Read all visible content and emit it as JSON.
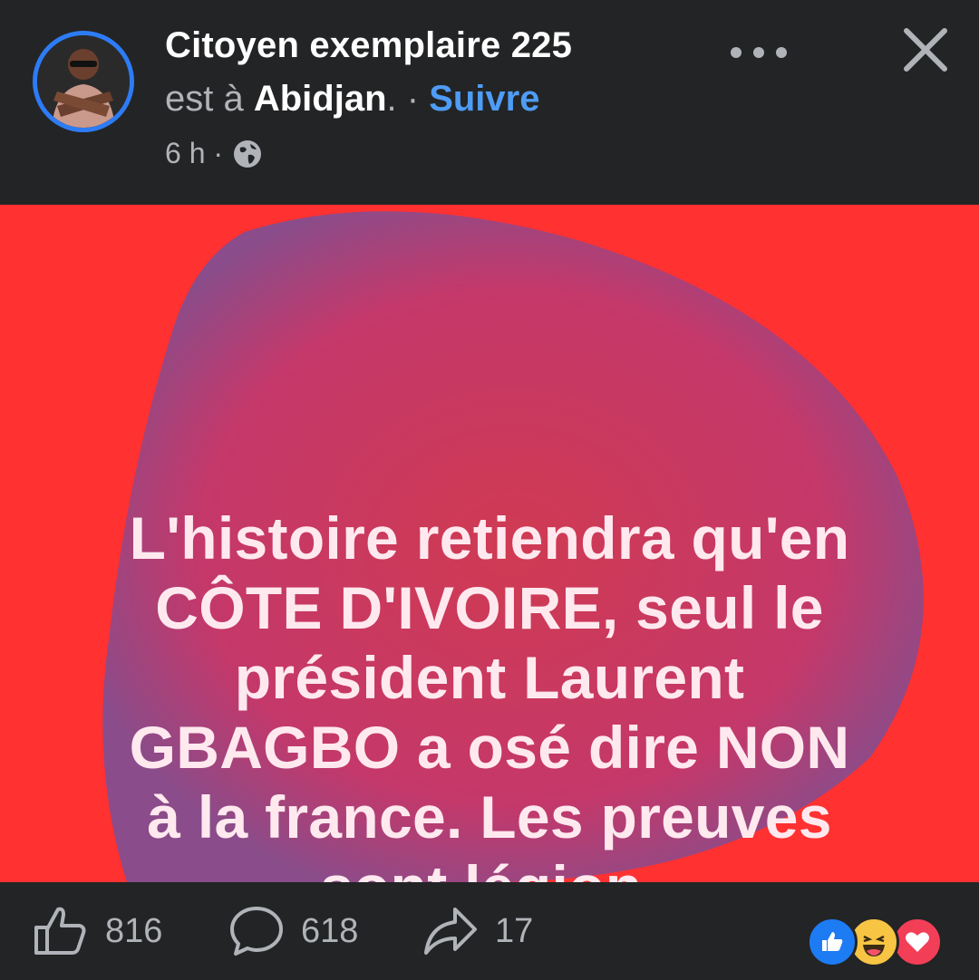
{
  "header": {
    "author_name": "Citoyen exemplaire 225",
    "location_prefix": "est à ",
    "location_place": "Abidjan",
    "location_suffix": ". · ",
    "follow_label": "Suivre",
    "time": "6 h ·"
  },
  "post": {
    "text": "L'histoire retiendra qu'en\nCÔTE D'IVOIRE, seul le\nprésident Laurent\nGBAGBO a osé dire NON\nà la france. Les preuves\nsont légion.",
    "background_color": "#ff3131",
    "blob_color": "#c4386a",
    "text_color": "#ffe9ef"
  },
  "footer": {
    "likes": "816",
    "comments": "618",
    "shares": "17",
    "reactions": [
      "like-icon",
      "haha-icon",
      "love-icon"
    ]
  },
  "colors": {
    "background": "#232425",
    "accent": "#4e9cf5",
    "avatar_ring": "#2d7cf6",
    "muted_text": "#b0b3b8"
  }
}
